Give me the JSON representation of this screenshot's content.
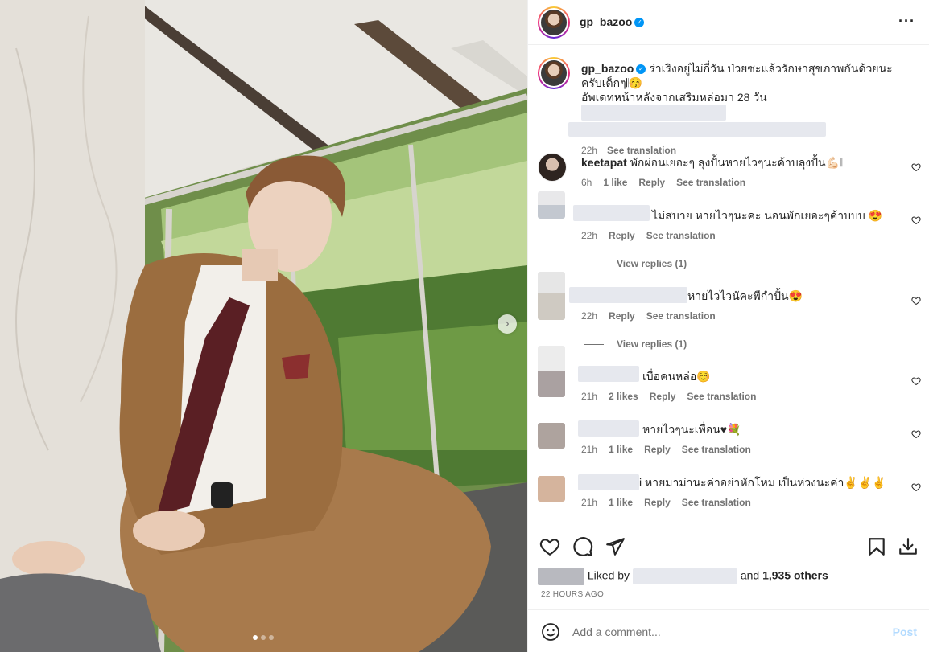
{
  "post": {
    "username": "gp_bazoo",
    "verified_icon": "verified-badge-icon",
    "caption_line1": "ร่าเริงอยู่ไม่กี่วัน ป่วยซะแล้วรักษาสุขภาพกันด้วยนะครับเด็กๆ𝄃😚",
    "caption_line2": "อัพเดทหน้าหลังจากเสริมหล่อมา 28 วัน",
    "caption_time": "22h",
    "see_translation": "See translation",
    "carousel_dots": 3,
    "carousel_active_index": 0,
    "next_arrow": "›",
    "more_icon": "···"
  },
  "comments": [
    {
      "username": "keetapat",
      "text": "พักผ่อนเยอะๆ ลุงปั้นหายไวๆนะค้าบลุงปั้น💪🏻𝄃",
      "time": "6h",
      "likes": "1 like",
      "reply": "Reply",
      "translate": "See translation"
    },
    {
      "username": "",
      "text": "ไม่สบาย หายไวๆนะคะ นอนพักเยอะๆค้าบบบ 😍",
      "time": "22h",
      "likes": "",
      "reply": "Reply",
      "translate": "See translation",
      "view_replies": "View replies (1)"
    },
    {
      "username": "",
      "text": "หายไวไวนัคะพีกำปั้น😍",
      "time": "22h",
      "likes": "",
      "reply": "Reply",
      "translate": "See translation",
      "view_replies": "View replies (1)"
    },
    {
      "username": "",
      "text": "เบื่อคนหล่อ☺️",
      "time": "21h",
      "likes": "2 likes",
      "reply": "Reply",
      "translate": "See translation"
    },
    {
      "username": "",
      "text": "หายไวๆนะเพื่อน♥💐",
      "time": "21h",
      "likes": "1 like",
      "reply": "Reply",
      "translate": "See translation"
    },
    {
      "username": "",
      "text": "i หายมาม่านะค่าอย่าหักโหม เป็นห่วงนะค่า✌✌✌",
      "time": "21h",
      "likes": "1 like",
      "reply": "Reply",
      "translate": "See translation"
    }
  ],
  "likes": {
    "liked_by": "Liked by",
    "and": "and",
    "others": "1,935 others"
  },
  "time_ago": "22 HOURS AGO",
  "add_comment": {
    "placeholder": "Add a comment...",
    "post_label": "Post"
  },
  "colors": {
    "accent_blue": "#0095f6",
    "post_disabled": "#b3dbff",
    "muted_text": "#737373"
  }
}
